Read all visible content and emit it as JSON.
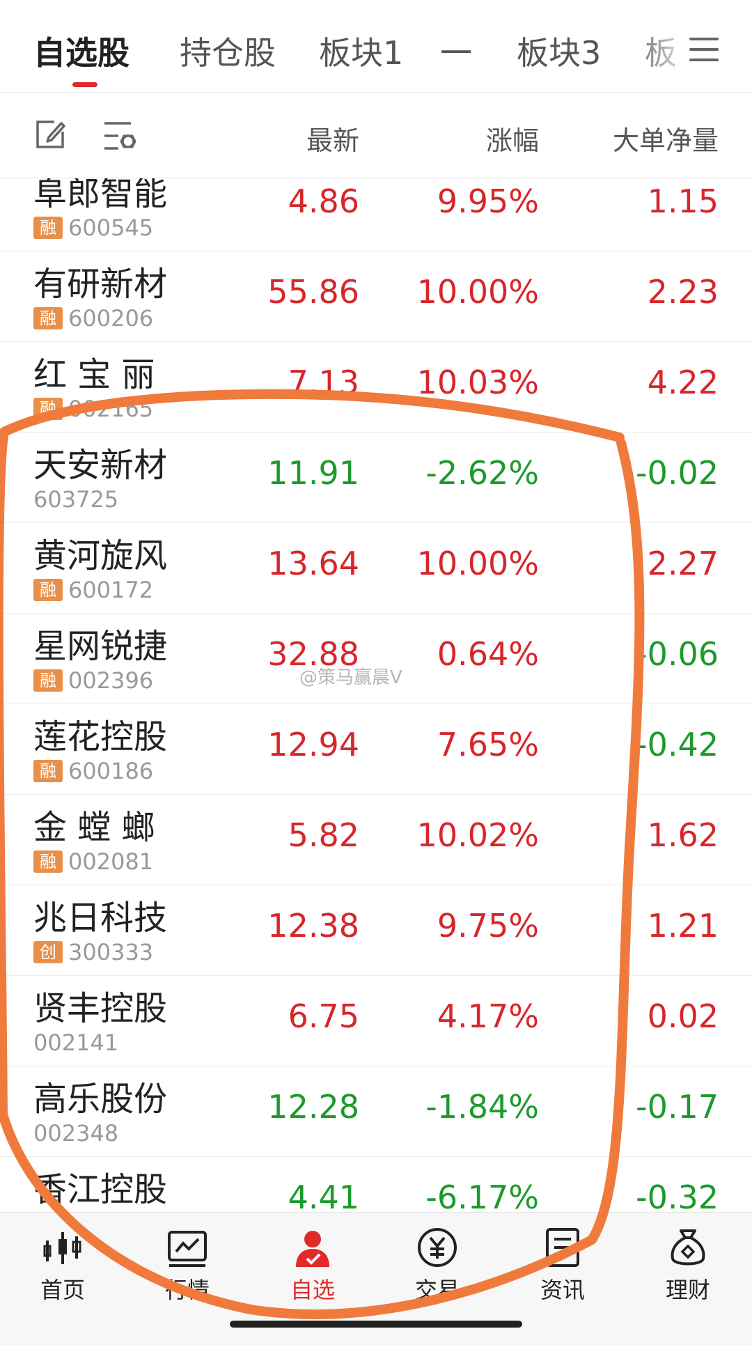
{
  "tabs": [
    {
      "label": "自选股",
      "active": true
    },
    {
      "label": "持仓股",
      "active": false
    },
    {
      "label": "板块1",
      "active": false
    },
    {
      "label": "一",
      "active": false
    },
    {
      "label": "板块3",
      "active": false
    },
    {
      "label": "板",
      "active": false
    }
  ],
  "columns": {
    "latest": "最新",
    "change": "涨幅",
    "net": "大单净量"
  },
  "stocks": [
    {
      "name": "阜郎智能",
      "badge": "融",
      "code": "600545",
      "price": "4.86",
      "change": "9.95%",
      "net": "1.15",
      "trend": "up"
    },
    {
      "name": "有研新材",
      "badge": "融",
      "code": "600206",
      "price": "55.86",
      "change": "10.00%",
      "net": "2.23",
      "trend": "up"
    },
    {
      "name": "红 宝 丽",
      "badge": "融",
      "code": "002165",
      "price": "7.13",
      "change": "10.03%",
      "net": "4.22",
      "trend": "up"
    },
    {
      "name": "天安新材",
      "badge": "",
      "code": "603725",
      "price": "11.91",
      "change": "-2.62%",
      "net": "-0.02",
      "trend": "down"
    },
    {
      "name": "黄河旋风",
      "badge": "融",
      "code": "600172",
      "price": "13.64",
      "change": "10.00%",
      "net": "2.27",
      "trend": "up"
    },
    {
      "name": "星网锐捷",
      "badge": "融",
      "code": "002396",
      "price": "32.88",
      "change": "0.64%",
      "net": "-0.06",
      "trend": "up",
      "net_trend": "down"
    },
    {
      "name": "莲花控股",
      "badge": "融",
      "code": "600186",
      "price": "12.94",
      "change": "7.65%",
      "net": "-0.42",
      "trend": "up",
      "net_trend": "down"
    },
    {
      "name": "金 螳 螂",
      "badge": "融",
      "code": "002081",
      "price": "5.82",
      "change": "10.02%",
      "net": "1.62",
      "trend": "up"
    },
    {
      "name": "兆日科技",
      "badge": "创",
      "code": "300333",
      "price": "12.38",
      "change": "9.75%",
      "net": "1.21",
      "trend": "up"
    },
    {
      "name": "贤丰控股",
      "badge": "",
      "code": "002141",
      "price": "6.75",
      "change": "4.17%",
      "net": "0.02",
      "trend": "up"
    },
    {
      "name": "高乐股份",
      "badge": "",
      "code": "002348",
      "price": "12.28",
      "change": "-1.84%",
      "net": "-0.17",
      "trend": "down"
    },
    {
      "name": "香江控股",
      "badge": "",
      "code": "",
      "price": "4.41",
      "change": "-6.17%",
      "net": "-0.32",
      "trend": "down"
    }
  ],
  "watermark": "@策马赢晨V",
  "nav": [
    {
      "label": "首页",
      "icon": "home-icon",
      "active": false
    },
    {
      "label": "行情",
      "icon": "chart-icon",
      "active": false
    },
    {
      "label": "自选",
      "icon": "watchlist-icon",
      "active": true
    },
    {
      "label": "交易",
      "icon": "yen-icon",
      "active": false
    },
    {
      "label": "资讯",
      "icon": "news-icon",
      "active": false
    },
    {
      "label": "理财",
      "icon": "money-bag-icon",
      "active": false
    }
  ],
  "colors": {
    "up": "#d7262b",
    "down": "#1c9a2c",
    "accent": "#e02a2a",
    "annotation": "#f07a3c",
    "badge": "#e8904a"
  }
}
